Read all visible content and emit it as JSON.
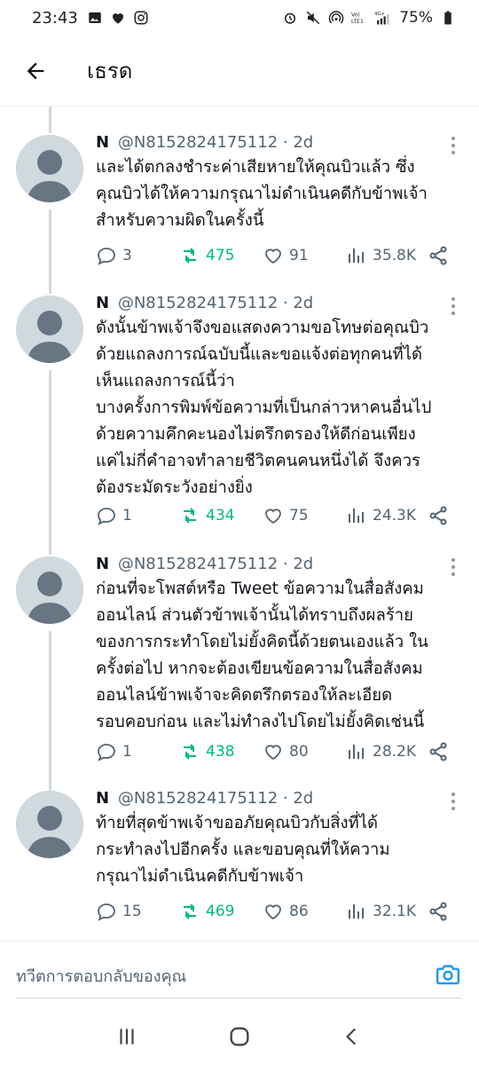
{
  "status_bar": {
    "time": "23:43",
    "battery": "75%"
  },
  "header": {
    "title": "เธรด"
  },
  "tweets": [
    {
      "name": "N",
      "handle": "@N8152824175112",
      "time": "2d",
      "lines": [
        "และได้ตกลงชำระค่าเสียหายให้คุณบิวแล้ว ซึ่ง",
        "คุณบิวได้ให้ความกรุณาไม่ดำเนินคดีกับข้าพเจ้า",
        "สำหรับความผิดในครั้งนี้"
      ],
      "replies": "3",
      "retweets": "475",
      "likes": "91",
      "views": "35.8K"
    },
    {
      "name": "N",
      "handle": "@N8152824175112",
      "time": "2d",
      "lines": [
        "ดังนั้นข้าพเจ้าจึงขอแสดงความขอโทษต่อคุณบิว",
        "ด้วยแถลงการณ์ฉบับนี้และขอแจ้งต่อทุกคนที่ได้",
        "เห็นแถลงการณ์นี้ว่า",
        "บางครั้งการพิมพ์ข้อความที่เป็นกล่าวหาคนอื่นไป",
        "ด้วยความคึกคะนองไม่ตรึกตรองให้ดีก่อนเพียง",
        "แค่ไม่กี่คำอาจทำลายชีวิตคนคนหนึ่งได้ จึงควร",
        "ต้องระมัดระวังอย่างยิ่ง"
      ],
      "replies": "1",
      "retweets": "434",
      "likes": "75",
      "views": "24.3K"
    },
    {
      "name": "N",
      "handle": "@N8152824175112",
      "time": "2d",
      "lines": [
        "ก่อนที่จะโพสต์หรือ Tweet ข้อความในสื่อสังคม",
        "ออนไลน์ ส่วนตัวข้าพเจ้านั้นได้ทราบถึงผลร้าย",
        "ของการกระทำโดยไม่ยั้งคิดนี้ด้วยตนเองแล้ว ใน",
        "ครั้งต่อไป หากจะต้องเขียนข้อความในสื่อสังคม",
        "ออนไลน์ข้าพเจ้าจะคิดตรึกตรองให้ละเอียด",
        "รอบคอบก่อน และไม่ทำลงไปโดยไม่ยั้งคิดเช่นนี้"
      ],
      "replies": "1",
      "retweets": "438",
      "likes": "80",
      "views": "28.2K"
    },
    {
      "name": "N",
      "handle": "@N8152824175112",
      "time": "2d",
      "lines": [
        "ท้ายที่สุดข้าพเจ้าขออภัยคุณบิวกับสิ่งที่ได้",
        "กระทำลงไปอีกครั้ง และขอบคุณที่ให้ความ",
        "กรุณาไม่ดำเนินคดีกับข้าพเจ้า"
      ],
      "replies": "15",
      "retweets": "469",
      "likes": "86",
      "views": "32.1K"
    }
  ],
  "reply_bar": {
    "placeholder": "ทวีตการตอบกลับของคุณ"
  },
  "colors": {
    "retweet": "#00ba7c",
    "secondary_text": "#536471",
    "accent": "#1d9bf0"
  }
}
